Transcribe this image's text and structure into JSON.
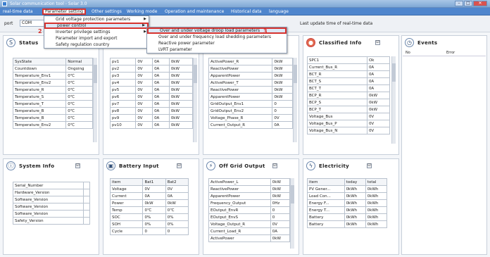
{
  "window": {
    "title": "Solar communication tool - Solar 3.0"
  },
  "menu": {
    "items": [
      "real-time data",
      "Parameter setting",
      "Other settings",
      "Working mode",
      "Operation and maintenance",
      "Historical data",
      "language"
    ]
  },
  "toolbar": {
    "port_label": "port",
    "port_value": "COM",
    "update_label": "Last update time of real-time data"
  },
  "dropdown": {
    "items": [
      "Grid voltage protection parameters",
      "power control",
      "Inverter privilege settings",
      "Parameter import and export",
      "Safety regulation country"
    ]
  },
  "submenu": {
    "items": [
      "Over and under voltage droop load parameters",
      "Over and under frequency load shedding parameters",
      "Reactive power parameter",
      "LVRT parameter"
    ]
  },
  "markers": [
    "2",
    "3"
  ],
  "status": {
    "title": "Status",
    "col2": "Actual",
    "rows": [
      [
        "SysState",
        "Normal"
      ],
      [
        "Countdown",
        "Ongoing"
      ],
      [
        "Temperature_Env1",
        "0℃"
      ],
      [
        "Temperature_Env2",
        "0℃"
      ],
      [
        "Temperature_R",
        "0℃"
      ],
      [
        "Temperature_S",
        "0℃"
      ],
      [
        "Temperature_T",
        "0℃"
      ],
      [
        "Temperature_B",
        "0℃"
      ],
      [
        "Temperature_B",
        "0℃"
      ],
      [
        "Temperature_Env2",
        "0℃"
      ]
    ]
  },
  "pv": {
    "rows": [
      [
        "pv1",
        "0V",
        "0A",
        "0kW"
      ],
      [
        "pv2",
        "0V",
        "0A",
        "0kW"
      ],
      [
        "pv3",
        "0V",
        "0A",
        "0kW"
      ],
      [
        "pv4",
        "0V",
        "0A",
        "0kW"
      ],
      [
        "pv5",
        "0V",
        "0A",
        "0kW"
      ],
      [
        "pv6",
        "0V",
        "0A",
        "0kW"
      ],
      [
        "pv7",
        "0V",
        "0A",
        "0kW"
      ],
      [
        "pv8",
        "0V",
        "0A",
        "0kW"
      ],
      [
        "pv9",
        "0V",
        "0A",
        "0kW"
      ],
      [
        "pv10",
        "0V",
        "0A",
        "0kW"
      ]
    ]
  },
  "power": {
    "rows": [
      [
        "ActivePower_R",
        "0kW"
      ],
      [
        "ReactivePower",
        "0kW"
      ],
      [
        "ApparentPower",
        "0kW"
      ],
      [
        "ActivePower_T",
        "0kW"
      ],
      [
        "ReactivePower",
        "0kW"
      ],
      [
        "ApparentPower",
        "0kW"
      ],
      [
        "GridOutput_Env1",
        "0"
      ],
      [
        "GridOutput_Env2",
        "0"
      ],
      [
        "Voltage_Phase_R",
        "0V"
      ],
      [
        "Current_Output_R",
        "0A"
      ]
    ]
  },
  "classified": {
    "title": "Classified Info",
    "rows": [
      [
        "SPC1",
        "Ok"
      ],
      [
        "Current_Bus_R",
        "0A"
      ],
      [
        "BCT_R",
        "0A"
      ],
      [
        "BCT_S",
        "0A"
      ],
      [
        "BCT_T",
        "0A"
      ],
      [
        "BCP_R",
        "0kW"
      ],
      [
        "BCP_S",
        "0kW"
      ],
      [
        "BCP_T",
        "0kW"
      ],
      [
        "Voltage_Bus",
        "0V"
      ],
      [
        "Voltage_Bus_P",
        "0V"
      ],
      [
        "Voltage_Bus_N",
        "0V"
      ]
    ]
  },
  "events": {
    "title": "Events",
    "col1": "No",
    "col2": "Error"
  },
  "system": {
    "title": "System Info",
    "rows": [
      [
        "Serial_Number",
        ""
      ],
      [
        "Hardware_Version",
        ""
      ],
      [
        "Software_Version",
        ""
      ],
      [
        "Software_Version",
        ""
      ],
      [
        "Software_Version",
        ""
      ],
      [
        "Safety_Version",
        ""
      ]
    ]
  },
  "battery": {
    "title": "Battery Input",
    "header": [
      "item",
      "Bat1",
      "Bat2"
    ],
    "rows": [
      [
        "Voltage",
        "0V",
        "0V"
      ],
      [
        "Current",
        "0A",
        "0A"
      ],
      [
        "Power",
        "0kW",
        "0kW"
      ],
      [
        "Temp",
        "0℃",
        "0℃"
      ],
      [
        "SOC",
        "0%",
        "0%"
      ],
      [
        "SOH",
        "0%",
        "0%"
      ],
      [
        "Cycle",
        "0",
        "0"
      ]
    ]
  },
  "offgrid": {
    "title": "Off Grid Output",
    "rows": [
      [
        "ActivePower_L",
        "0kW"
      ],
      [
        "ReactivePower",
        "0kW"
      ],
      [
        "ApparentPower",
        "0kW"
      ],
      [
        "Frequency_Output",
        "0Hz"
      ],
      [
        "EOutput_EnvR",
        "0"
      ],
      [
        "EOutput_EnvS",
        "0"
      ],
      [
        "Voltage_Output_R",
        "0V"
      ],
      [
        "Current_Load_R",
        "0A"
      ],
      [
        "ActivePower",
        "0kW"
      ]
    ]
  },
  "electricity": {
    "title": "Electricity",
    "header": [
      "item",
      "today",
      "total"
    ],
    "rows": [
      [
        "PV Gener...",
        "0kWh",
        "0kWh"
      ],
      [
        "Load Con...",
        "0kWh",
        "0kWh"
      ],
      [
        "Energy F...",
        "0kWh",
        "0kWh"
      ],
      [
        "Energy T...",
        "0kWh",
        "0kWh"
      ],
      [
        "Battery",
        "0kWh",
        "0kWh"
      ],
      [
        "Battery",
        "0kWh",
        "0kWh"
      ]
    ]
  },
  "checkbox_mark": "☑",
  "icons": {
    "status": "S",
    "pv": "☀",
    "power": "⚡",
    "classified": "●",
    "events": "◷",
    "system": "ⓘ",
    "battery": "▣",
    "offgrid": "⚡",
    "electricity": "ϟ"
  }
}
